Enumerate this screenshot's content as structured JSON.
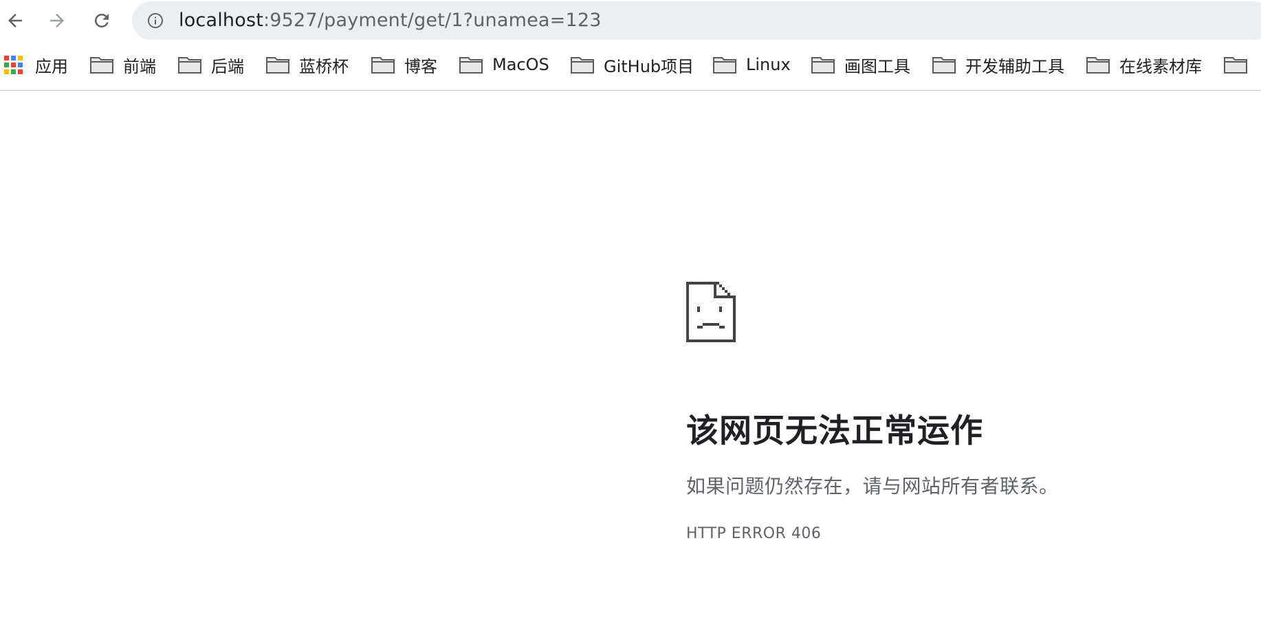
{
  "address_bar": {
    "host": "localhost",
    "path": ":9527/payment/get/1?unamea=123"
  },
  "bookmarks": {
    "apps_label": "应用",
    "items": [
      {
        "label": "前端"
      },
      {
        "label": "后端"
      },
      {
        "label": "蓝桥杯"
      },
      {
        "label": "博客"
      },
      {
        "label": "MacOS"
      },
      {
        "label": "GitHub项目"
      },
      {
        "label": "Linux"
      },
      {
        "label": "画图工具"
      },
      {
        "label": "开发辅助工具"
      },
      {
        "label": "在线素材库"
      }
    ]
  },
  "error_page": {
    "title": "该网页无法正常运作",
    "message": "如果问题仍然存在，请与网站所有者联系。",
    "code": "HTTP ERROR 406"
  },
  "colors": {
    "omnibox_bg": "#eceff1",
    "icon_dark": "#444444",
    "text_primary": "#202124",
    "text_secondary": "#5f6368"
  },
  "icons": [
    "back-arrow-icon",
    "forward-arrow-icon",
    "reload-icon",
    "info-icon",
    "apps-grid-icon",
    "folder-icon",
    "sad-document-icon"
  ]
}
